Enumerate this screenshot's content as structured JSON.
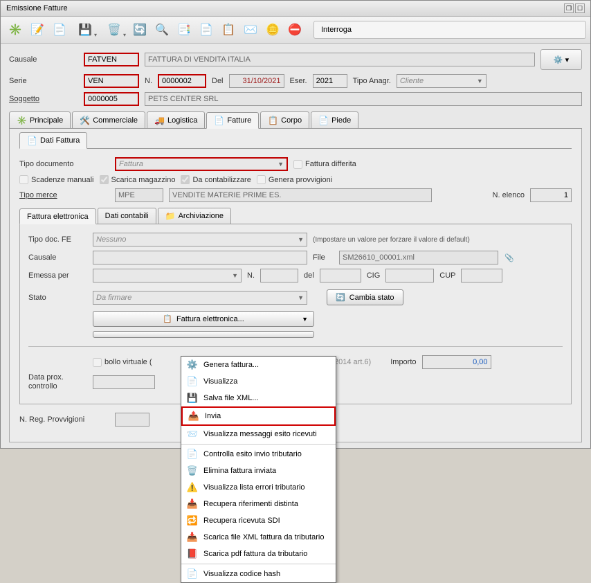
{
  "window": {
    "title": "Emissione Fatture"
  },
  "toolbar": {
    "interroga": "Interroga"
  },
  "header": {
    "causale_label": "Causale",
    "causale": "FATVEN",
    "causale_desc": "FATTURA DI VENDITA ITALIA",
    "serie_label": "Serie",
    "serie": "VEN",
    "n_label": "N.",
    "n": "0000002",
    "del_label": "Del",
    "del": "31/10/2021",
    "eser_label": "Eser.",
    "eser": "2021",
    "tipo_anagr_label": "Tipo Anagr.",
    "tipo_anagr": "Cliente",
    "soggetto_label": "Soggetto",
    "soggetto": "0000005",
    "soggetto_desc": "PETS CENTER SRL"
  },
  "tabs_main": {
    "principale": "Principale",
    "commerciale": "Commerciale",
    "logistica": "Logistica",
    "fatture": "Fatture",
    "corpo": "Corpo",
    "piede": "Piede"
  },
  "subtabs": {
    "dati_fattura": "Dati Fattura"
  },
  "dati_fattura": {
    "tipo_doc_label": "Tipo documento",
    "tipo_doc_value": "Fattura",
    "fattura_differita": "Fattura differita",
    "scadenze_manuali": "Scadenze manuali",
    "scarica_magazzino": "Scarica magazzino",
    "da_contabilizzare": "Da contabilizzare",
    "genera_provvigioni": "Genera provvigioni",
    "tipo_merce_label": "Tipo merce",
    "tipo_merce": "MPE",
    "tipo_merce_desc": "VENDITE MATERIE PRIME ES.",
    "n_elenco_label": "N. elenco",
    "n_elenco": "1"
  },
  "tabs_fe": {
    "fe": "Fattura elettronica",
    "dati_contabili": "Dati contabili",
    "archiviazione": "Archiviazione"
  },
  "fe": {
    "tipo_doc_fe_label": "Tipo doc. FE",
    "tipo_doc_fe": "Nessuno",
    "hint": "(Impostare un valore per forzare il valore di default)",
    "causale_label": "Causale",
    "file_label": "File",
    "file": "SM26610_00001.xml",
    "emessa_per_label": "Emessa per",
    "n_label": "N.",
    "del_label": "del",
    "cig_label": "CIG",
    "cup_label": "CUP",
    "stato_label": "Stato",
    "stato": "Da firmare",
    "cambia_stato": "Cambia stato",
    "fe_btn": "Fattura elettronica...",
    "bollo_virtuale": "bollo virtuale (",
    "bollo_suffix": "ugno 2014 art.6)",
    "importo_label": "Importo",
    "importo": "0,00",
    "data_prox_label": "Data prox. controllo",
    "n_reg_label": "N. Reg. Provvigioni"
  },
  "menu": {
    "genera": "Genera fattura...",
    "visualizza": "Visualizza",
    "salva_xml": "Salva file XML...",
    "invia": "Invia",
    "visual_msg": "Visualizza messaggi esito ricevuti",
    "controlla": "Controlla esito invio tributario",
    "elimina": "Elimina fattura inviata",
    "lista_errori": "Visualizza lista errori tributario",
    "recupera_dist": "Recupera riferimenti distinta",
    "recupera_sdi": "Recupera ricevuta SDI",
    "scarica_xml": "Scarica file XML fattura da tributario",
    "scarica_pdf": "Scarica pdf fattura da tributario",
    "codice_hash": "Visualizza codice hash"
  }
}
